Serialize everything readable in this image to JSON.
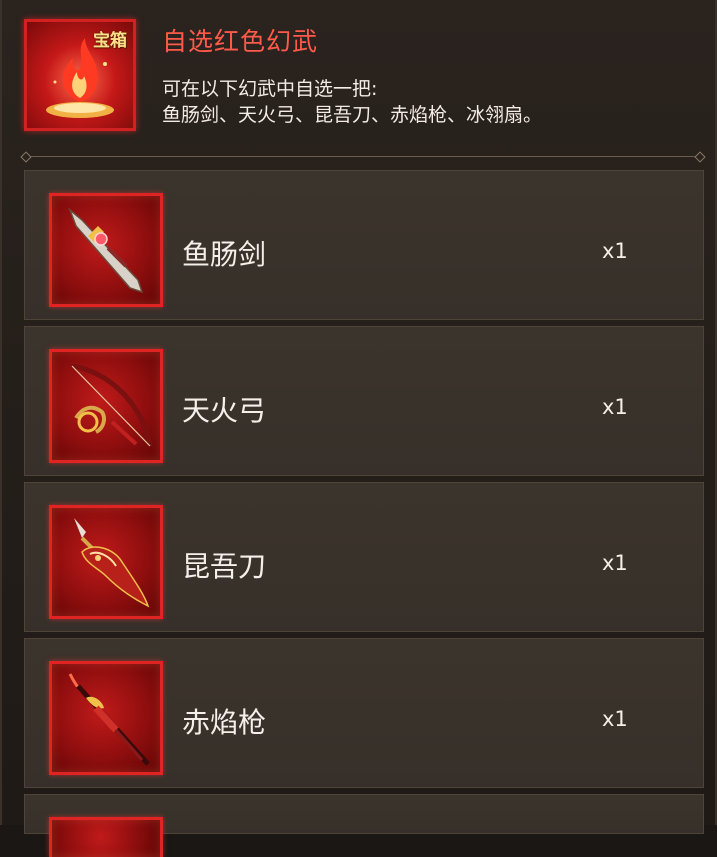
{
  "header": {
    "badge": "宝箱",
    "title": "自选红色幻武",
    "description_line1": "可在以下幻武中自选一把:",
    "description_line2": "鱼肠剑、天火弓、昆吾刀、赤焰枪、冰翎扇。"
  },
  "items": [
    {
      "name": "鱼肠剑",
      "quantity": "x1",
      "icon": "sword-icon"
    },
    {
      "name": "天火弓",
      "quantity": "x1",
      "icon": "bow-icon"
    },
    {
      "name": "昆吾刀",
      "quantity": "x1",
      "icon": "blade-icon"
    },
    {
      "name": "赤焰枪",
      "quantity": "x1",
      "icon": "spear-icon"
    }
  ],
  "colors": {
    "title": "#ff5a4a",
    "rarity_border": "#e02424",
    "panel": "#37302a",
    "text": "#f4efe8"
  }
}
